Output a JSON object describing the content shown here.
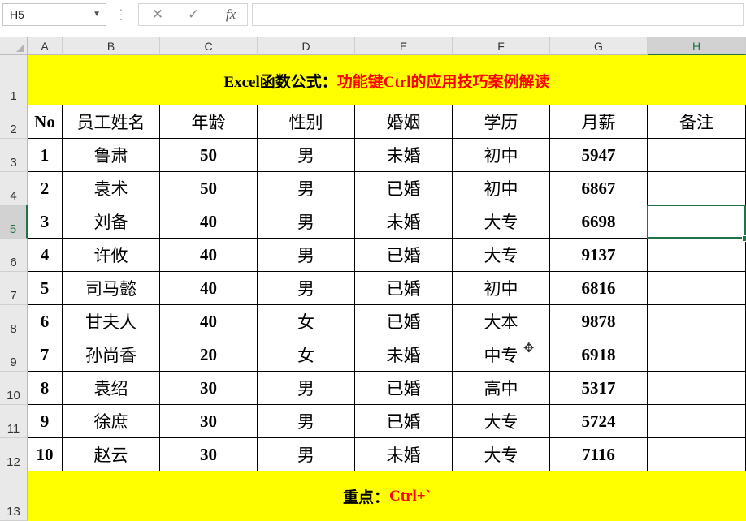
{
  "formula_bar": {
    "name_box": "H5",
    "cancel_icon": "✕",
    "enter_icon": "✓",
    "fx_icon": "fx",
    "formula": ""
  },
  "columns": [
    "A",
    "B",
    "C",
    "D",
    "E",
    "F",
    "G",
    "H"
  ],
  "rows": [
    "1",
    "2",
    "3",
    "4",
    "5",
    "6",
    "7",
    "8",
    "9",
    "10",
    "11",
    "12",
    "13"
  ],
  "title": {
    "black": "Excel函数公式：",
    "red": "功能键Ctrl的应用技巧案例解读"
  },
  "table": {
    "headers": [
      "No",
      "员工姓名",
      "年龄",
      "性别",
      "婚姻",
      "学历",
      "月薪",
      "备注"
    ],
    "rows": [
      [
        "1",
        "鲁肃",
        "50",
        "男",
        "未婚",
        "初中",
        "5947",
        ""
      ],
      [
        "2",
        "袁术",
        "50",
        "男",
        "已婚",
        "初中",
        "6867",
        ""
      ],
      [
        "3",
        "刘备",
        "40",
        "男",
        "未婚",
        "大专",
        "6698",
        ""
      ],
      [
        "4",
        "许攸",
        "40",
        "男",
        "已婚",
        "大专",
        "9137",
        ""
      ],
      [
        "5",
        "司马懿",
        "40",
        "男",
        "已婚",
        "初中",
        "6816",
        ""
      ],
      [
        "6",
        "甘夫人",
        "40",
        "女",
        "已婚",
        "大本",
        "9878",
        ""
      ],
      [
        "7",
        "孙尚香",
        "20",
        "女",
        "未婚",
        "中专",
        "6918",
        ""
      ],
      [
        "8",
        "袁绍",
        "30",
        "男",
        "已婚",
        "高中",
        "5317",
        ""
      ],
      [
        "9",
        "徐庶",
        "30",
        "男",
        "已婚",
        "大专",
        "5724",
        ""
      ],
      [
        "10",
        "赵云",
        "30",
        "男",
        "未婚",
        "大专",
        "7116",
        ""
      ]
    ]
  },
  "footer": {
    "black": "重点：",
    "red": "Ctrl+`"
  },
  "colors": {
    "band": "#ffff00",
    "accent": "#217346",
    "red": "#ff0000"
  }
}
